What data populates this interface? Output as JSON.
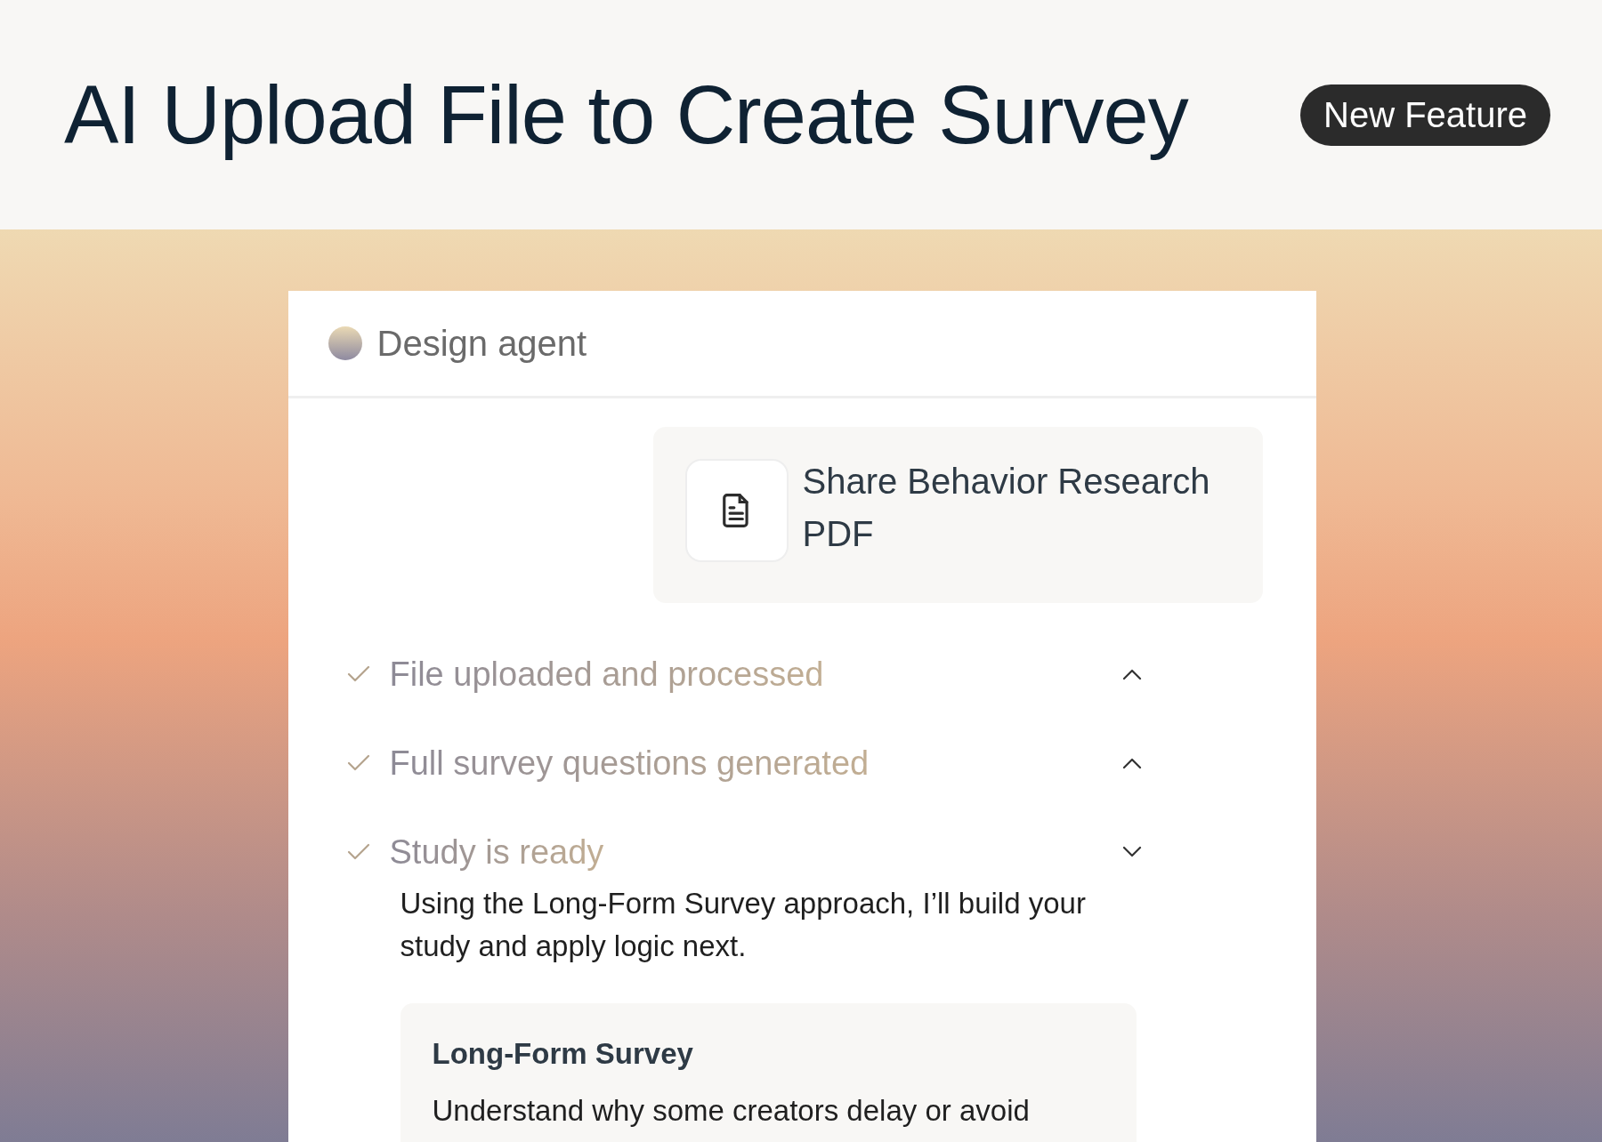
{
  "header": {
    "title": "AI Upload File to Create Survey",
    "badge": "New Feature"
  },
  "panel": {
    "title": "Design agent",
    "attachment": {
      "name": "Share Behavior Research PDF"
    },
    "steps": [
      {
        "label": "File uploaded and processed",
        "checked": true,
        "expanded": false
      },
      {
        "label": "Full survey questions generated",
        "checked": true,
        "expanded": false
      },
      {
        "label": "Study is ready",
        "checked": true,
        "expanded": true,
        "message": "Using the Long-Form Survey approach, I’ll build your study and apply logic next.",
        "option": {
          "title": "Long-Form Survey",
          "description": "Understand why some creators delay or avoid"
        }
      }
    ]
  }
}
